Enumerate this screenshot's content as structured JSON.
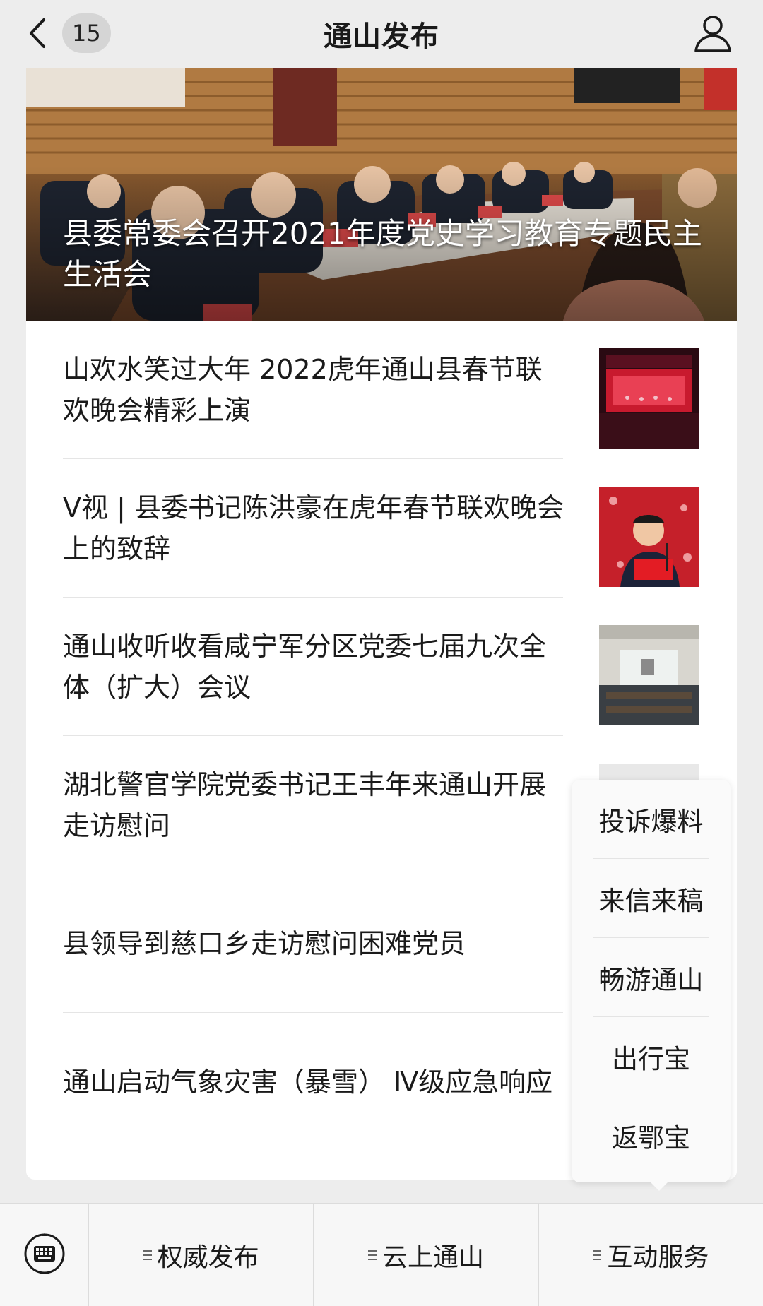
{
  "topbar": {
    "unread_count": "15",
    "title": "通山发布"
  },
  "hero": {
    "title": "县委常委会召开2021年度党史学习教育专题民主生活会"
  },
  "articles": [
    {
      "title": "山欢水笑过大年 2022虎年通山县春节联欢晚会精彩上演",
      "thumb": "stage-performance"
    },
    {
      "title": "V视 | 县委书记陈洪豪在虎年春节联欢晚会上的致辞",
      "thumb": "speaker-at-podium"
    },
    {
      "title": "通山收听收看咸宁军分区党委七届九次全体（扩大）会议",
      "thumb": "meeting-room"
    },
    {
      "title": "湖北警官学院党委书记王丰年来通山开展走访慰问",
      "thumb": "partial-photo"
    },
    {
      "title": "县领导到慈口乡走访慰问困难党员",
      "thumb": ""
    },
    {
      "title": "通山启动气象灾害（暴雪） Ⅳ级应急响应",
      "thumb": ""
    }
  ],
  "popup_menu": {
    "items": [
      "投诉爆料",
      "来信来稿",
      "畅游通山",
      "出行宝",
      "返鄂宝"
    ]
  },
  "bottom_menu": {
    "items": [
      "权威发布",
      "云上通山",
      "互动服务"
    ]
  },
  "icons": {
    "back": "chevron-left-icon",
    "profile": "person-icon",
    "keyboard": "keyboard-icon",
    "menu": "hamburger-icon"
  }
}
